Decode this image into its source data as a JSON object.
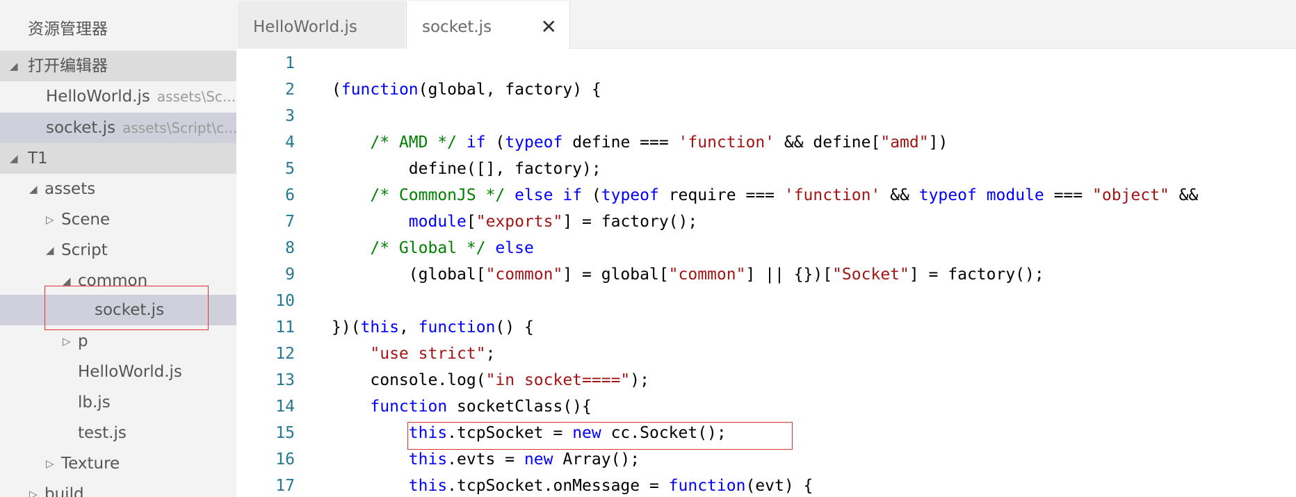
{
  "sidebar": {
    "title": "资源管理器",
    "sections": {
      "open_editors": "打开编辑器",
      "project": "T1"
    },
    "open_editors": [
      {
        "name": "HelloWorld.js",
        "path": "assets\\Sc..."
      },
      {
        "name": "socket.js",
        "path": "assets\\Script\\c..."
      }
    ],
    "tree": [
      {
        "label": "assets",
        "twisty": "▲"
      },
      {
        "label": "Scene",
        "twisty": "▷"
      },
      {
        "label": "Script",
        "twisty": "▲"
      },
      {
        "label": "common",
        "twisty": "▲"
      },
      {
        "label": "socket.js",
        "twisty": ""
      },
      {
        "label": "p",
        "twisty": "▷"
      },
      {
        "label": "HelloWorld.js",
        "twisty": ""
      },
      {
        "label": "lb.js",
        "twisty": ""
      },
      {
        "label": "test.js",
        "twisty": ""
      },
      {
        "label": "Texture",
        "twisty": "▷"
      },
      {
        "label": "build",
        "twisty": "▷"
      }
    ]
  },
  "tabs": [
    {
      "label": "HelloWorld.js",
      "active": false
    },
    {
      "label": "socket.js",
      "active": true
    }
  ],
  "tab_close_glyph": "✕",
  "colors": {
    "keyword": "#0000ff",
    "string": "#a31515",
    "comment": "#008000",
    "line_number": "#237893",
    "highlight_box": "#e03030",
    "selected_row": "#cfd0dc"
  },
  "code_lines": [
    {
      "n": "1",
      "tokens": []
    },
    {
      "n": "2",
      "tokens": [
        [
          "p",
          "("
        ],
        [
          "k",
          "function"
        ],
        [
          "p",
          "(global, factory) {"
        ]
      ]
    },
    {
      "n": "3",
      "tokens": []
    },
    {
      "n": "4",
      "tokens": [
        [
          "p",
          "    "
        ],
        [
          "c",
          "/* AMD */ "
        ],
        [
          "k",
          "if"
        ],
        [
          "p",
          " ("
        ],
        [
          "k",
          "typeof"
        ],
        [
          "p",
          " define === "
        ],
        [
          "s",
          "'function'"
        ],
        [
          "p",
          " && define["
        ],
        [
          "s",
          "\"amd\""
        ],
        [
          "p",
          "])"
        ]
      ]
    },
    {
      "n": "5",
      "tokens": [
        [
          "p",
          "        define([], factory);"
        ]
      ]
    },
    {
      "n": "6",
      "tokens": [
        [
          "p",
          "    "
        ],
        [
          "c",
          "/* CommonJS */ "
        ],
        [
          "k",
          "else if"
        ],
        [
          "p",
          " ("
        ],
        [
          "k",
          "typeof"
        ],
        [
          "p",
          " require === "
        ],
        [
          "s",
          "'function'"
        ],
        [
          "p",
          " && "
        ],
        [
          "k",
          "typeof"
        ],
        [
          "p",
          " "
        ],
        [
          "k",
          "module"
        ],
        [
          "p",
          " === "
        ],
        [
          "s",
          "\"object\""
        ],
        [
          "p",
          " &&"
        ]
      ]
    },
    {
      "n": "7",
      "tokens": [
        [
          "p",
          "        "
        ],
        [
          "k",
          "module"
        ],
        [
          "p",
          "["
        ],
        [
          "s",
          "\"exports\""
        ],
        [
          "p",
          "] = factory();"
        ]
      ]
    },
    {
      "n": "8",
      "tokens": [
        [
          "p",
          "    "
        ],
        [
          "c",
          "/* Global */ "
        ],
        [
          "k",
          "else"
        ]
      ]
    },
    {
      "n": "9",
      "tokens": [
        [
          "p",
          "        (global["
        ],
        [
          "s",
          "\"common\""
        ],
        [
          "p",
          "] = global["
        ],
        [
          "s",
          "\"common\""
        ],
        [
          "p",
          "] || {})["
        ],
        [
          "s",
          "\"Socket\""
        ],
        [
          "p",
          "] = factory();"
        ]
      ]
    },
    {
      "n": "10",
      "tokens": []
    },
    {
      "n": "11",
      "tokens": [
        [
          "p",
          "})("
        ],
        [
          "k",
          "this"
        ],
        [
          "p",
          ", "
        ],
        [
          "k",
          "function"
        ],
        [
          "p",
          "() {"
        ]
      ]
    },
    {
      "n": "12",
      "tokens": [
        [
          "p",
          "    "
        ],
        [
          "s",
          "\"use strict\""
        ],
        [
          "p",
          ";"
        ]
      ]
    },
    {
      "n": "13",
      "tokens": [
        [
          "p",
          "    console.log("
        ],
        [
          "s",
          "\"in socket====\""
        ],
        [
          "p",
          ");"
        ]
      ]
    },
    {
      "n": "14",
      "tokens": [
        [
          "p",
          "    "
        ],
        [
          "k",
          "function"
        ],
        [
          "p",
          " socketClass(){"
        ]
      ]
    },
    {
      "n": "15",
      "tokens": [
        [
          "p",
          "        "
        ],
        [
          "k",
          "this"
        ],
        [
          "p",
          ".tcpSocket = "
        ],
        [
          "k",
          "new"
        ],
        [
          "p",
          " cc.Socket();"
        ]
      ]
    },
    {
      "n": "16",
      "tokens": [
        [
          "p",
          "        "
        ],
        [
          "k",
          "this"
        ],
        [
          "p",
          ".evts = "
        ],
        [
          "k",
          "new"
        ],
        [
          "p",
          " Array();"
        ]
      ]
    },
    {
      "n": "17",
      "tokens": [
        [
          "p",
          "        "
        ],
        [
          "k",
          "this"
        ],
        [
          "p",
          ".tcpSocket.onMessage = "
        ],
        [
          "k",
          "function"
        ],
        [
          "p",
          "(evt) {"
        ]
      ]
    }
  ]
}
